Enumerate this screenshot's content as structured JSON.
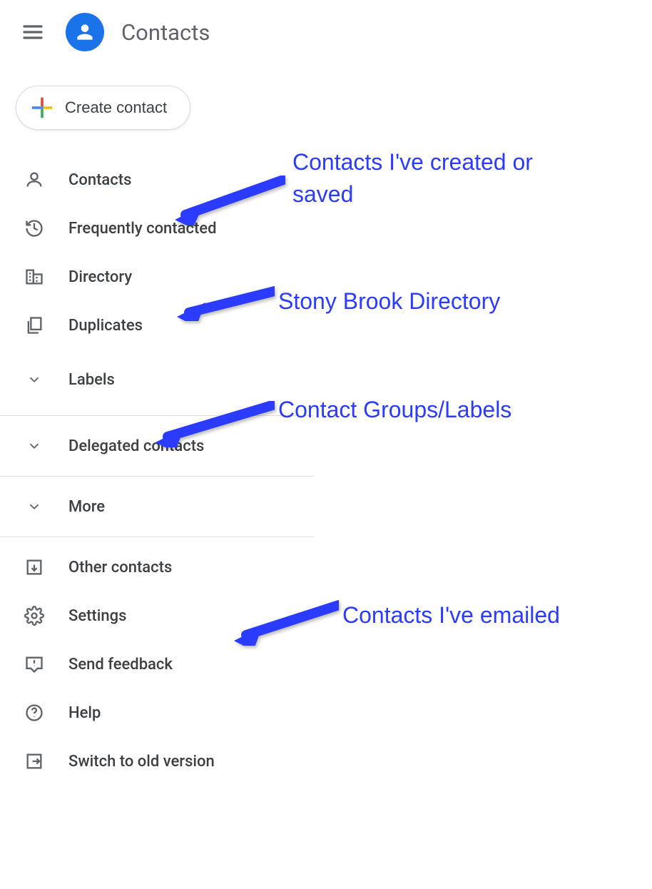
{
  "header": {
    "app_title": "Contacts"
  },
  "create_button": {
    "label": "Create contact"
  },
  "menu": {
    "contacts": "Contacts",
    "frequently_contacted": "Frequently contacted",
    "directory": "Directory",
    "duplicates": "Duplicates",
    "labels": "Labels",
    "delegated_contacts": "Delegated contacts",
    "more": "More",
    "other_contacts": "Other contacts",
    "settings": "Settings",
    "send_feedback": "Send feedback",
    "help": "Help",
    "switch_old": "Switch to old version"
  },
  "annotations": {
    "contacts_note": "Contacts I've created or saved",
    "directory_note": "Stony Brook Directory",
    "labels_note": "Contact Groups/Labels",
    "other_note": "Contacts I've emailed"
  }
}
